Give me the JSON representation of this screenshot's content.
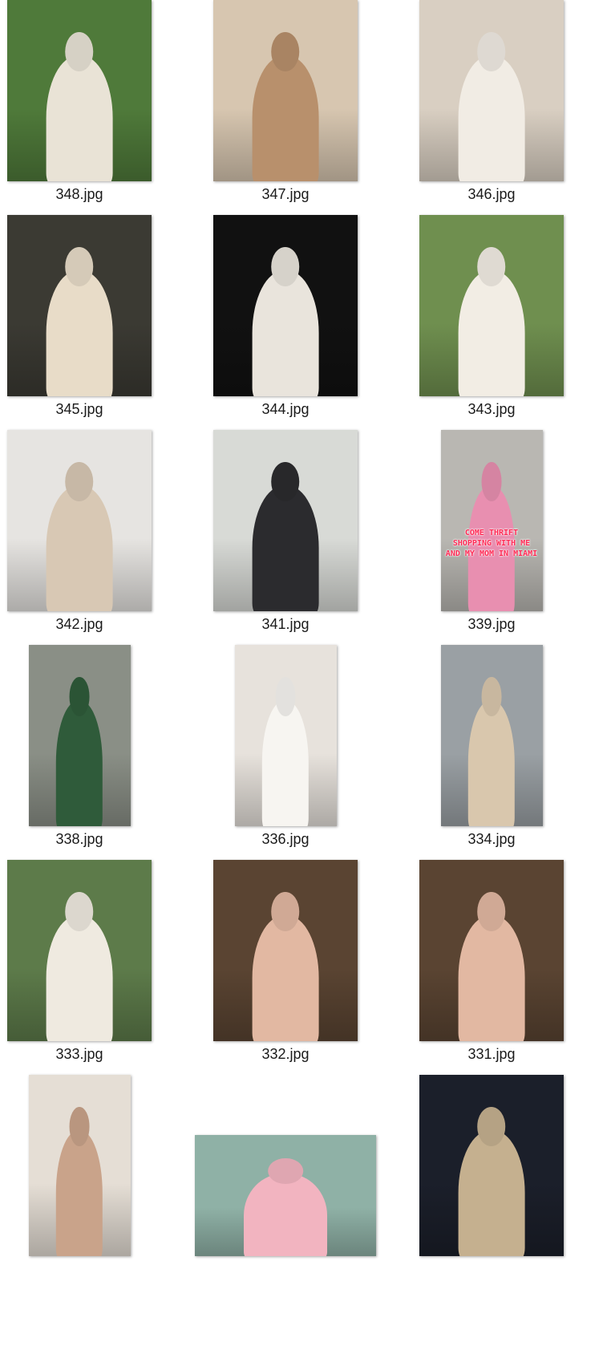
{
  "files": [
    {
      "name": "348.jpg",
      "orientation": "portrait",
      "bg": "#4f7a3a",
      "fg": "#e9e3d6"
    },
    {
      "name": "347.jpg",
      "orientation": "portrait",
      "bg": "#d7c6b0",
      "fg": "#b8906c"
    },
    {
      "name": "346.jpg",
      "orientation": "portrait",
      "bg": "#d9cfc2",
      "fg": "#f1ece4"
    },
    {
      "name": "345.jpg",
      "orientation": "portrait",
      "bg": "#3b3a33",
      "fg": "#e8dcc8"
    },
    {
      "name": "344.jpg",
      "orientation": "portrait",
      "bg": "#111111",
      "fg": "#e9e4dc"
    },
    {
      "name": "343.jpg",
      "orientation": "portrait",
      "bg": "#6f8f4f",
      "fg": "#f2ede4"
    },
    {
      "name": "342.jpg",
      "orientation": "portrait",
      "bg": "#e6e4e1",
      "fg": "#d8c8b4"
    },
    {
      "name": "341.jpg",
      "orientation": "portrait",
      "bg": "#d8dad6",
      "fg": "#2b2b2e"
    },
    {
      "name": "339.jpg",
      "orientation": "tall",
      "bg": "#b9b7b2",
      "fg": "#e88fb0",
      "overlay_text": "COME THRIFT SHOPPING WITH ME AND MY MOM IN MIAMI"
    },
    {
      "name": "338.jpg",
      "orientation": "tall",
      "bg": "#8a8f86",
      "fg": "#2f5b3a"
    },
    {
      "name": "336.jpg",
      "orientation": "tall",
      "bg": "#e7e2dc",
      "fg": "#f7f5f1"
    },
    {
      "name": "334.jpg",
      "orientation": "tall",
      "bg": "#9aa0a4",
      "fg": "#d9c7ad"
    },
    {
      "name": "333.jpg",
      "orientation": "portrait",
      "bg": "#5d7b4a",
      "fg": "#efeae0"
    },
    {
      "name": "332.jpg",
      "orientation": "portrait",
      "bg": "#5a4432",
      "fg": "#e2b8a2"
    },
    {
      "name": "331.jpg",
      "orientation": "portrait",
      "bg": "#5a4432",
      "fg": "#e2b8a2"
    },
    {
      "name": "",
      "orientation": "tall",
      "bg": "#e5ded5",
      "fg": "#c9a38a"
    },
    {
      "name": "",
      "orientation": "landscape",
      "bg": "#8fb1a6",
      "fg": "#f2b4c0"
    },
    {
      "name": "",
      "orientation": "portrait",
      "bg": "#1b1f2a",
      "fg": "#c5b08f"
    }
  ]
}
